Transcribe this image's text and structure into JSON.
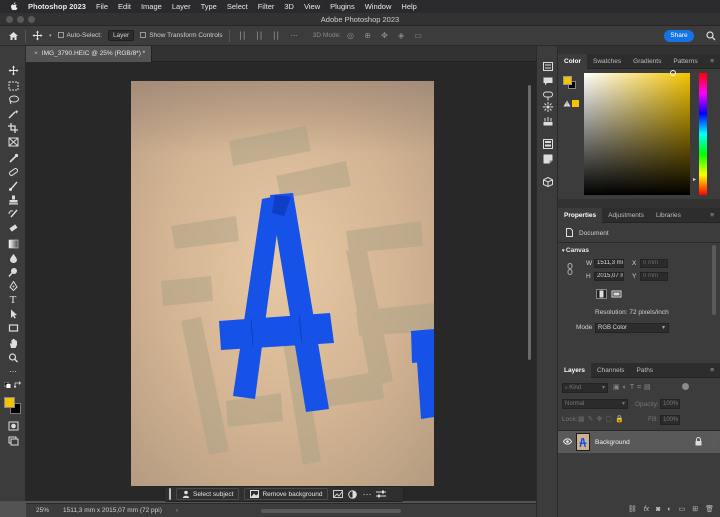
{
  "menubar": {
    "app_name": "Photoshop 2023",
    "items": [
      "File",
      "Edit",
      "Image",
      "Layer",
      "Type",
      "Select",
      "Filter",
      "3D",
      "View",
      "Plugins",
      "Window",
      "Help"
    ]
  },
  "window": {
    "title": "Adobe Photoshop 2023"
  },
  "options_bar": {
    "auto_select_label": "Auto-Select:",
    "auto_select_target": "Layer",
    "show_transform_label": "Show Transform Controls",
    "mode_3d_label": "3D Mode:",
    "share_label": "Share"
  },
  "document": {
    "tab_title": "IMG_3790.HEIC @ 25% (RGB/8*) *",
    "zoom": "25%",
    "dimensions": "1511,3 mm x 2015,07 mm (72 ppi)"
  },
  "task_bar": {
    "select_subject_label": "Select subject",
    "remove_background_label": "Remove background"
  },
  "color_panel": {
    "tabs": [
      "Color",
      "Swatches",
      "Gradients",
      "Patterns"
    ],
    "foreground": "#f5c400",
    "background": "#000000"
  },
  "properties_panel": {
    "tabs": [
      "Properties",
      "Adjustments",
      "Libraries"
    ],
    "doc_label": "Document",
    "section_title": "Canvas",
    "w_label": "W",
    "w_value": "1511,3 mm",
    "h_label": "H",
    "h_value": "2015,07 mm",
    "x_label": "X",
    "x_value": "0 mm",
    "y_label": "Y",
    "y_value": "0 mm",
    "resolution": "Resolution: 72 pixels/inch",
    "mode_label": "Mode",
    "mode_value": "RGB Color"
  },
  "layers_panel": {
    "tabs": [
      "Layers",
      "Channels",
      "Paths"
    ],
    "filter_label": "Kind",
    "blend_mode": "Normal",
    "opacity_label": "Opacity:",
    "opacity_value": "100%",
    "lock_label": "Lock:",
    "fill_label": "Fill:",
    "fill_value": "100%",
    "layers": [
      {
        "name": "Background"
      }
    ],
    "footer_fx": "fx"
  },
  "colors": {
    "accent": "#1473e6",
    "tape_blue": "#1652e8"
  }
}
